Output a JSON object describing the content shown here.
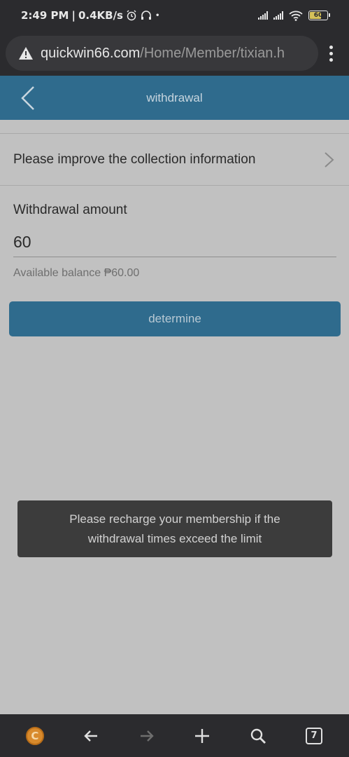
{
  "status_bar": {
    "time": "2:49 PM",
    "net_speed": "0.4KB/s",
    "battery": "60"
  },
  "browser": {
    "url_host": "quickwin66.com",
    "url_path": "/Home/Member/tixian.h"
  },
  "header": {
    "title": "withdrawal"
  },
  "collection": {
    "label": "Please improve the collection information"
  },
  "withdraw": {
    "amount_label": "Withdrawal amount",
    "amount_value": "60",
    "balance_text": "Available balance ₱60.00",
    "submit_label": "determine"
  },
  "toast": {
    "line1": "Please recharge your membership if the",
    "line2": "withdrawal times exceed the limit"
  },
  "bottom_nav": {
    "tab_count": "7",
    "coin_letter": "C"
  },
  "colors": {
    "accent": "#2f6b8d",
    "overlay_bg": "#c1c1c1",
    "toast_bg": "#3c3c3c"
  }
}
